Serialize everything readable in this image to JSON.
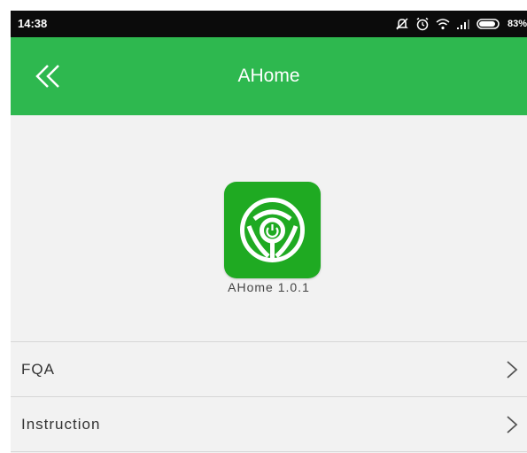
{
  "status_bar": {
    "time": "14:38",
    "battery_percent": "83%",
    "icons": [
      "mute-icon",
      "alarm-icon",
      "wifi-icon",
      "signal-icon",
      "battery-icon"
    ]
  },
  "header": {
    "title": "AHome",
    "back_icon": "double-chevron-left-icon",
    "background_color": "#2eb84f"
  },
  "about": {
    "logo_icon": "app-logo-icon",
    "version_text": "AHome 1.0.1"
  },
  "menu": {
    "items": [
      {
        "label": "FQA",
        "icon": "chevron-right-icon"
      },
      {
        "label": "Instruction",
        "icon": "chevron-right-icon"
      }
    ]
  }
}
